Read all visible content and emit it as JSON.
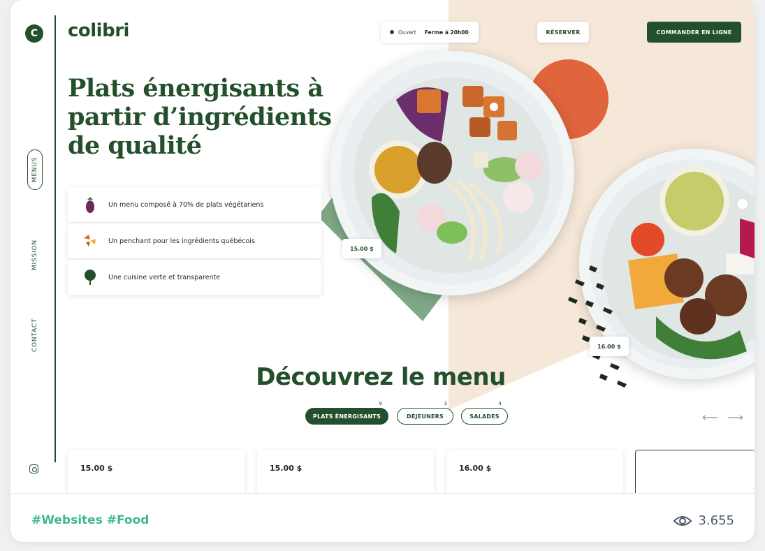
{
  "brand": {
    "logo_letter": "C",
    "name": "colibri"
  },
  "nav": {
    "menus": "MENUS",
    "mission": "MISSION",
    "contact": "CONTACT",
    "instagram_icon": "instagram-icon"
  },
  "header": {
    "status_open": "Ouvert",
    "status_hours": "Ferme à 20h00",
    "reserve_label": "RÉSERVER",
    "order_label": "COMMANDER EN LIGNE"
  },
  "hero": {
    "title": "Plats énergisants à partir d’ingrédients de qualité",
    "features": [
      {
        "icon": "eggplant-icon",
        "text": "Un menu composé à 70% de plats végétariens"
      },
      {
        "icon": "autumn-leaves-icon",
        "text": "Un penchant pour les ingrédients québécois"
      },
      {
        "icon": "tree-icon",
        "text": "Une cuisine verte et transparente"
      }
    ]
  },
  "dishes": [
    {
      "price": "15.00 $"
    },
    {
      "price": "16.00 $"
    }
  ],
  "menu_section": {
    "heading": "Découvrez le menu",
    "tabs": [
      {
        "label": "PLATS ÉNERGISANTS",
        "count": "9",
        "active": true
      },
      {
        "label": "DÉJEUNERS",
        "count": "3",
        "active": false
      },
      {
        "label": "SALADES",
        "count": "4",
        "active": false
      }
    ],
    "arrows": "⟵ ⟶",
    "cards": [
      {
        "price": "15.00 $"
      },
      {
        "price": "15.00 $"
      },
      {
        "price": "16.00 $"
      },
      {
        "price": ""
      }
    ]
  },
  "footer": {
    "tags": "#Websites #Food",
    "views": "3.655"
  },
  "colors": {
    "primary": "#234f2c",
    "accent_orange": "#e0643c",
    "beige": "#f6e8d9",
    "sage": "#7fa886",
    "tag_green": "#3dbb8a"
  }
}
